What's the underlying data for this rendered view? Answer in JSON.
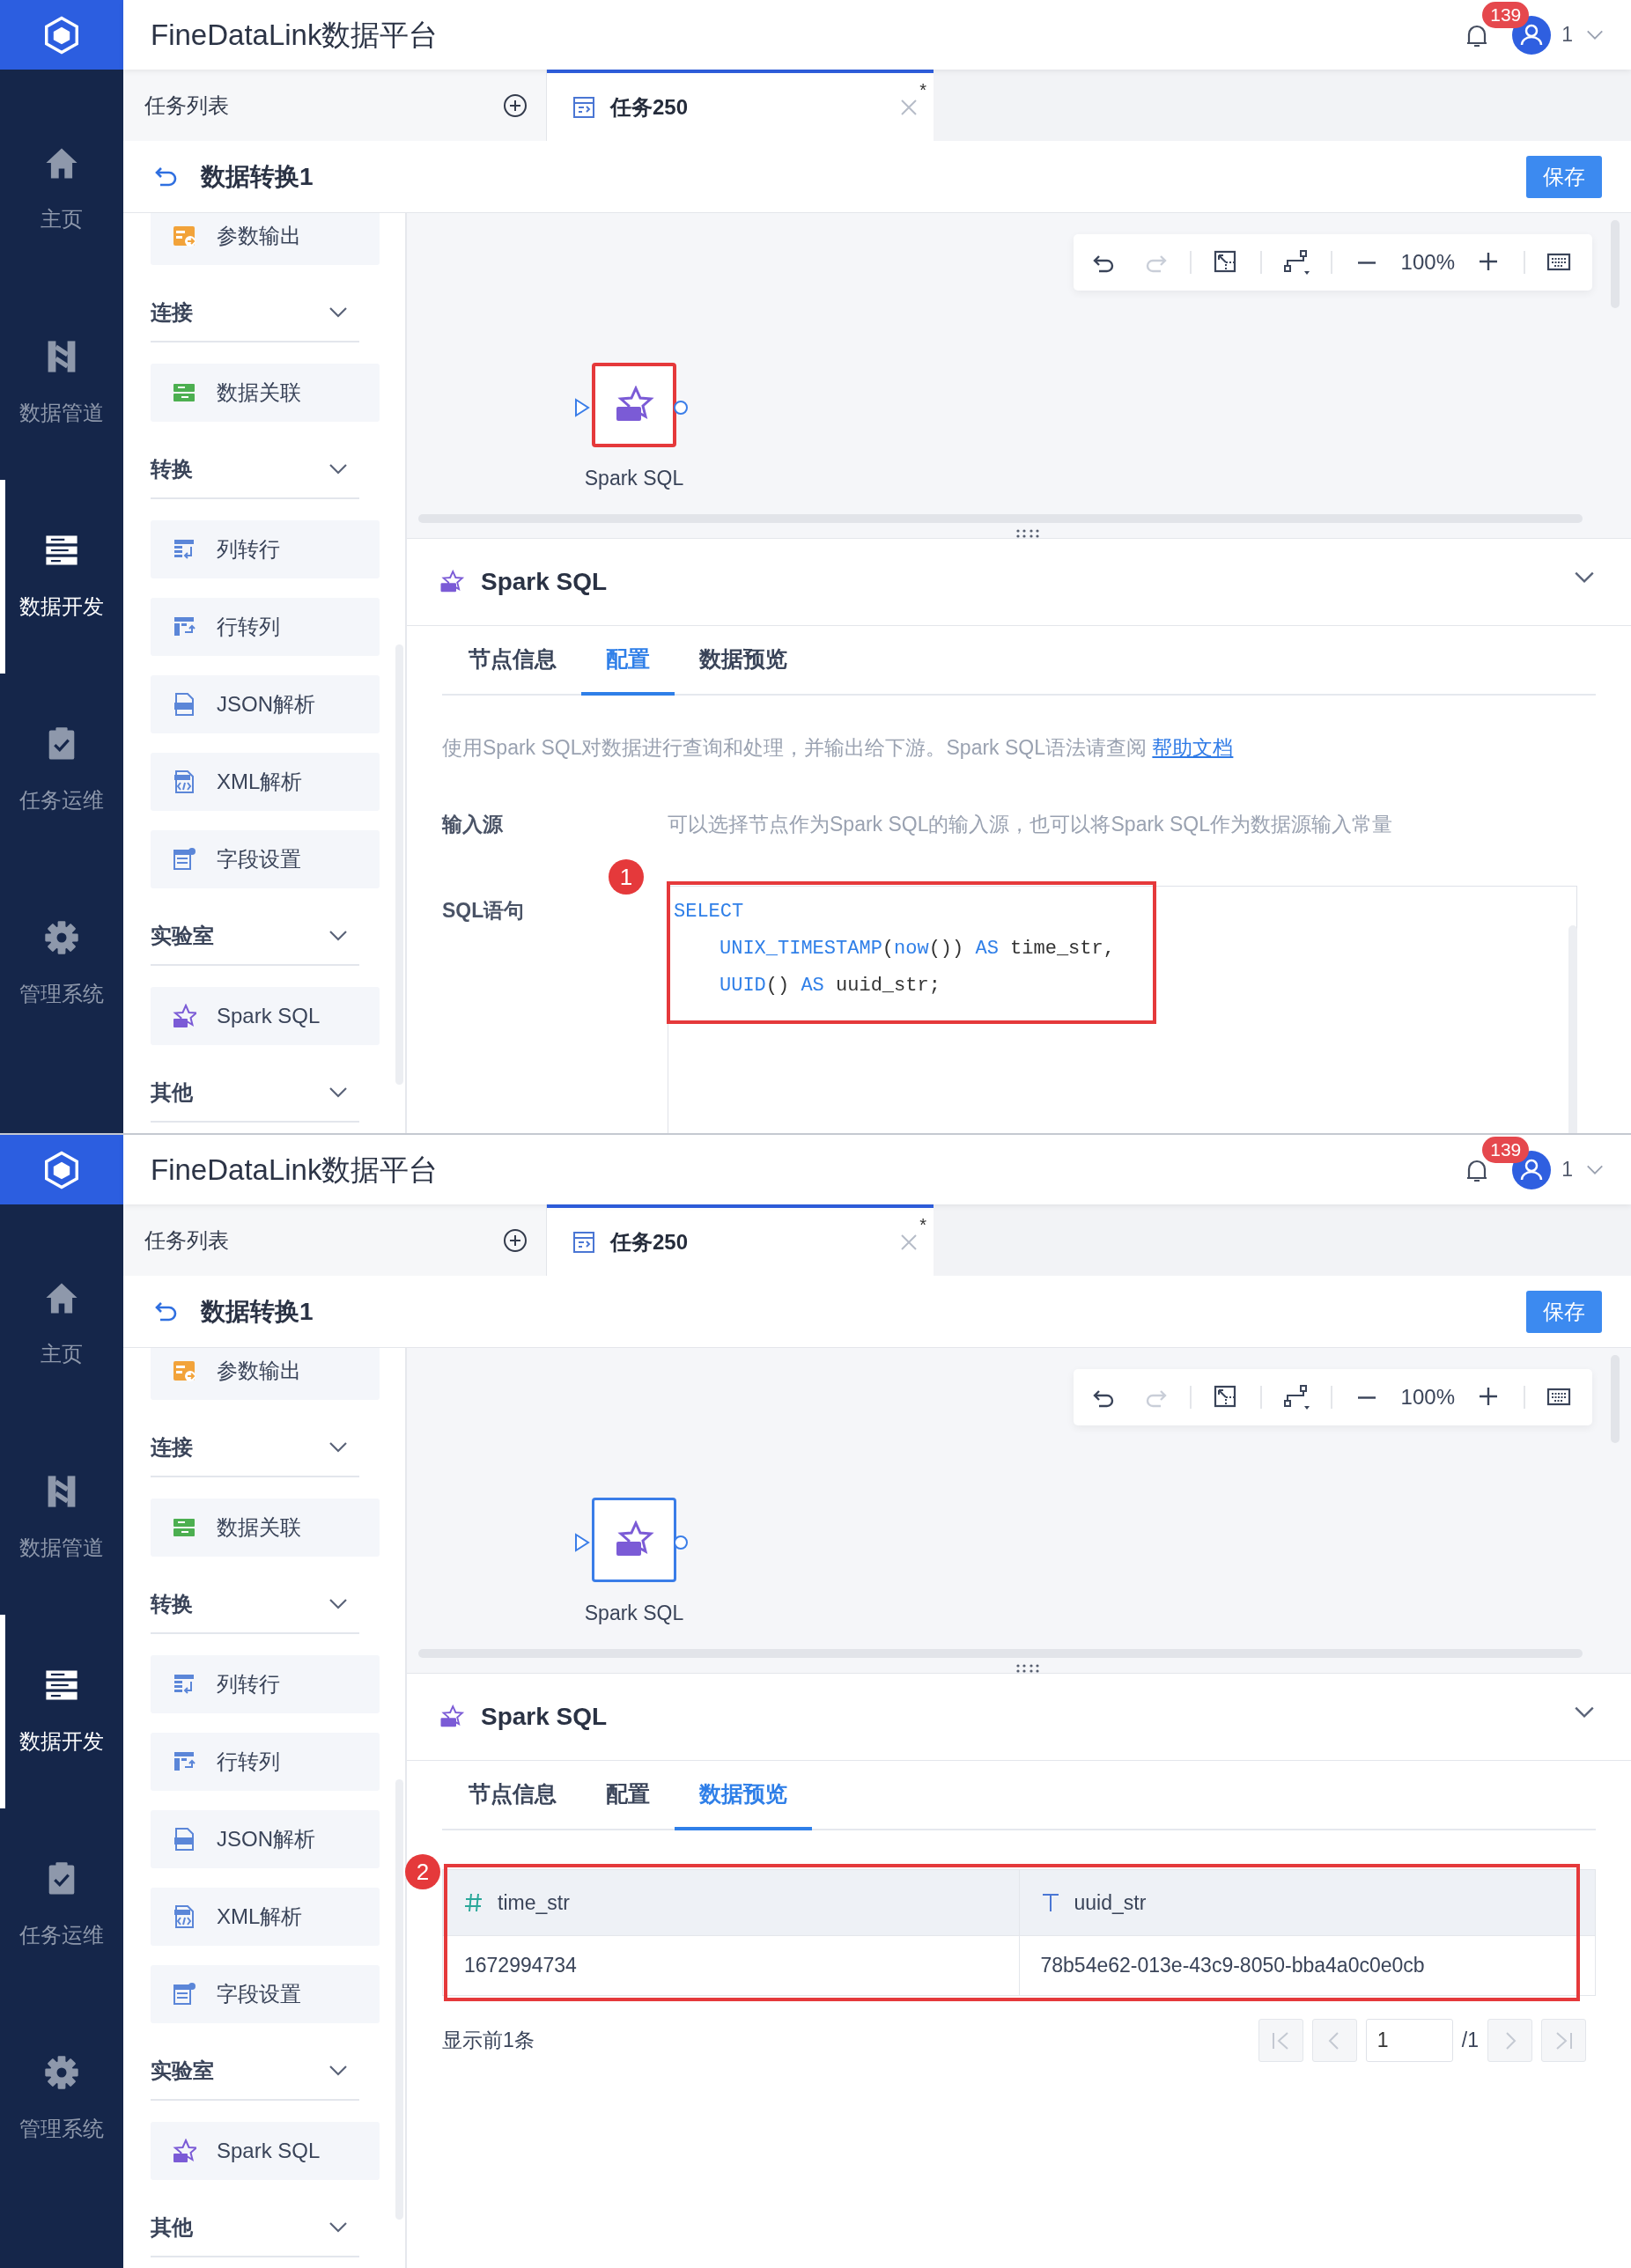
{
  "screens": [
    {
      "app_title": "FineDataLink数据平台",
      "notification_count": "139",
      "user_name": "1",
      "nav": [
        {
          "label": "主页",
          "selected": false
        },
        {
          "label": "数据管道",
          "selected": false
        },
        {
          "label": "数据开发",
          "selected": true
        },
        {
          "label": "任务运维",
          "selected": false
        },
        {
          "label": "管理系统",
          "selected": false
        }
      ],
      "task_list": "任务列表",
      "tabs": [
        {
          "label": "任务250",
          "selected": true,
          "unsaved_mark": "*"
        }
      ],
      "page_title": "数据转换1",
      "save_button": "保存",
      "palette": [
        {
          "kind": "item",
          "label": "参数输出"
        },
        {
          "kind": "group",
          "label": "连接",
          "expanded": true
        },
        {
          "kind": "item",
          "label": "数据关联"
        },
        {
          "kind": "group",
          "label": "转换",
          "expanded": true
        },
        {
          "kind": "item",
          "label": "列转行"
        },
        {
          "kind": "item",
          "label": "行转列"
        },
        {
          "kind": "item",
          "label": "JSON解析"
        },
        {
          "kind": "item",
          "label": "XML解析"
        },
        {
          "kind": "item",
          "label": "字段设置"
        },
        {
          "kind": "group",
          "label": "实验室",
          "expanded": true
        },
        {
          "kind": "item",
          "label": "Spark SQL"
        },
        {
          "kind": "group",
          "label": "其他",
          "expanded": true
        }
      ],
      "toolbar": [
        {
          "disabled": false
        },
        {
          "disabled": true
        },
        {
          "disabled": false
        },
        {
          "disabled": false
        },
        {
          "disabled": false
        },
        {
          "disabled": false
        },
        {
          "disabled": false
        }
      ],
      "zoom_level": "100%",
      "node": {
        "label": "Spark SQL",
        "annotated": true
      },
      "panel": {
        "title": "Spark SQL",
        "tabs": [
          {
            "label": "节点信息",
            "selected": false
          },
          {
            "label": "配置",
            "selected": true
          },
          {
            "label": "数据预览",
            "selected": false
          }
        ],
        "content": {
          "kind": "config",
          "callout": "1",
          "description": "使用Spark SQL对数据进行查询和处理，并输出给下游。Spark SQL语法请查阅",
          "help_link": "帮助文档",
          "input_label": "输入源",
          "input_hint": "可以选择节点作为Spark SQL的输入源，也可以将Spark SQL作为数据源输入常量",
          "sql_label": "SQL语句",
          "annotated": true,
          "code": [
            {
              "indented": false,
              "tokens": [
                {
                  "kind": "keyword",
                  "text": "SELECT"
                }
              ]
            },
            {
              "indented": true,
              "tokens": [
                {
                  "kind": "keyword",
                  "text": "UNIX_TIMESTAMP"
                },
                {
                  "kind": "plain",
                  "text": "("
                },
                {
                  "kind": "keyword",
                  "text": "now"
                },
                {
                  "kind": "plain",
                  "text": "()) "
                },
                {
                  "kind": "keyword",
                  "text": "AS"
                },
                {
                  "kind": "plain",
                  "text": " time_str,"
                }
              ]
            },
            {
              "indented": true,
              "tokens": [
                {
                  "kind": "keyword",
                  "text": "UUID"
                },
                {
                  "kind": "plain",
                  "text": "() "
                },
                {
                  "kind": "keyword",
                  "text": "AS"
                },
                {
                  "kind": "plain",
                  "text": " uuid_str;"
                }
              ]
            }
          ]
        }
      }
    },
    {
      "app_title": "FineDataLink数据平台",
      "notification_count": "139",
      "user_name": "1",
      "nav": [
        {
          "label": "主页",
          "selected": false
        },
        {
          "label": "数据管道",
          "selected": false
        },
        {
          "label": "数据开发",
          "selected": true
        },
        {
          "label": "任务运维",
          "selected": false
        },
        {
          "label": "管理系统",
          "selected": false
        }
      ],
      "task_list": "任务列表",
      "tabs": [
        {
          "label": "任务250",
          "selected": true,
          "unsaved_mark": "*"
        }
      ],
      "page_title": "数据转换1",
      "save_button": "保存",
      "palette": [
        {
          "kind": "item",
          "label": "参数输出"
        },
        {
          "kind": "group",
          "label": "连接",
          "expanded": true
        },
        {
          "kind": "item",
          "label": "数据关联"
        },
        {
          "kind": "group",
          "label": "转换",
          "expanded": true
        },
        {
          "kind": "item",
          "label": "列转行"
        },
        {
          "kind": "item",
          "label": "行转列"
        },
        {
          "kind": "item",
          "label": "JSON解析"
        },
        {
          "kind": "item",
          "label": "XML解析"
        },
        {
          "kind": "item",
          "label": "字段设置"
        },
        {
          "kind": "group",
          "label": "实验室",
          "expanded": true
        },
        {
          "kind": "item",
          "label": "Spark SQL"
        },
        {
          "kind": "group",
          "label": "其他",
          "expanded": true
        }
      ],
      "toolbar": [
        {
          "disabled": false
        },
        {
          "disabled": true
        },
        {
          "disabled": false
        },
        {
          "disabled": false
        },
        {
          "disabled": false
        },
        {
          "disabled": false
        },
        {
          "disabled": false
        }
      ],
      "zoom_level": "100%",
      "node": {
        "label": "Spark SQL",
        "annotated": false
      },
      "panel": {
        "title": "Spark SQL",
        "tabs": [
          {
            "label": "节点信息",
            "selected": false
          },
          {
            "label": "配置",
            "selected": false
          },
          {
            "label": "数据预览",
            "selected": true
          }
        ],
        "content": {
          "kind": "preview",
          "callout": "2",
          "annotated": true,
          "columns": [
            {
              "name": "time_str",
              "kind": "number"
            },
            {
              "name": "uuid_str",
              "kind": "text"
            }
          ],
          "rows": [
            [
              "1672994734",
              "78b54e62-013e-43c9-8050-bba4a0c0e0cb"
            ]
          ],
          "row_count_text": "显示前1条",
          "pager": {
            "buttons": [
              {
                "disabled": true
              },
              {
                "disabled": true
              },
              {
                "disabled": true
              },
              {
                "disabled": true
              }
            ],
            "page_value": "1",
            "page_total": "/1"
          }
        }
      }
    }
  ]
}
